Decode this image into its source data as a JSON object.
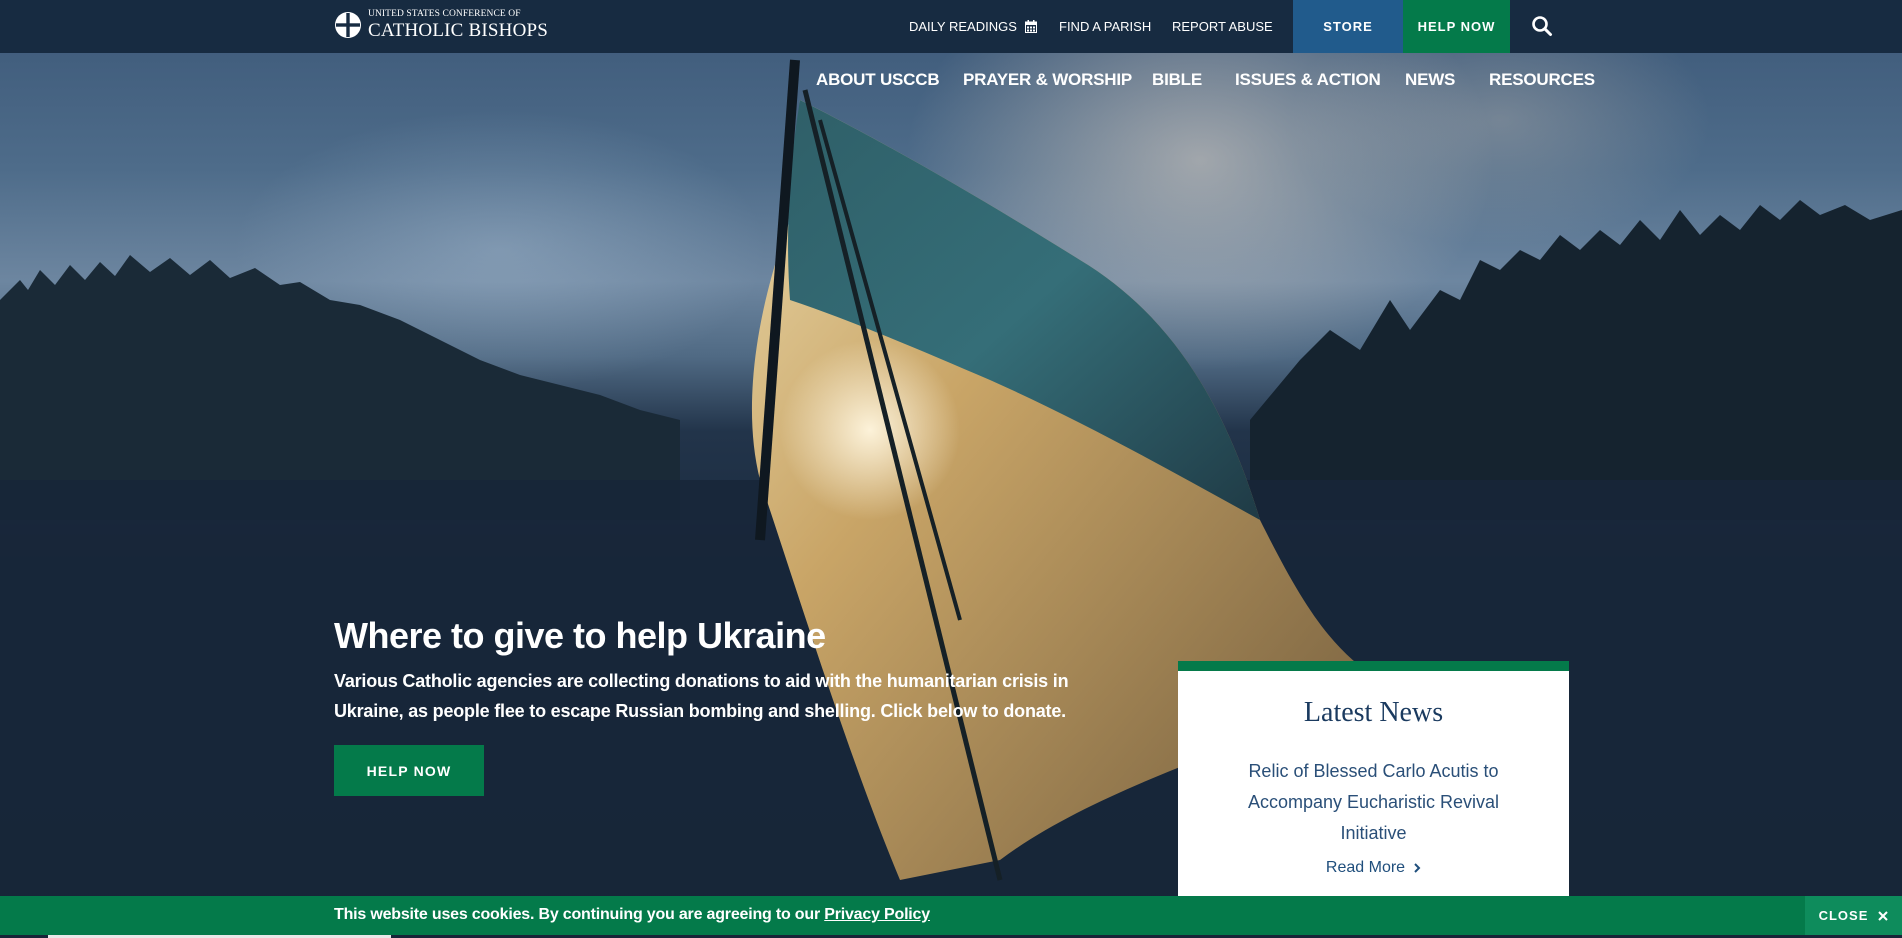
{
  "brand": {
    "logo_line1": "UNITED STATES CONFERENCE OF",
    "logo_line2": "CATHOLIC BISHOPS"
  },
  "utility_nav": {
    "daily_readings": "DAILY READINGS",
    "find_parish": "FIND A PARISH",
    "report_abuse": "REPORT ABUSE",
    "store": "STORE",
    "help_now": "HELP NOW"
  },
  "main_nav": [
    "ABOUT USCCB",
    "PRAYER & WORSHIP",
    "BIBLE",
    "ISSUES & ACTION",
    "NEWS",
    "RESOURCES"
  ],
  "hero": {
    "title": "Where to give to help Ukraine",
    "description": "Various Catholic agencies are collecting donations to aid with the humanitarian crisis in Ukraine, as people flee to escape Russian bombing and shelling. Click below to donate.",
    "button": "HELP NOW"
  },
  "latest_news": {
    "heading": "Latest News",
    "item": "Relic of Blessed Carlo Acutis to Accompany Eucharistic Revival Initiative",
    "read_more": "Read More"
  },
  "cookie": {
    "text": "This website uses cookies. By continuing you are agreeing to our ",
    "link": "Privacy Policy",
    "close": "CLOSE"
  },
  "colors": {
    "navy": "#172b41",
    "green": "#047a4a",
    "blue": "#215b8c"
  }
}
